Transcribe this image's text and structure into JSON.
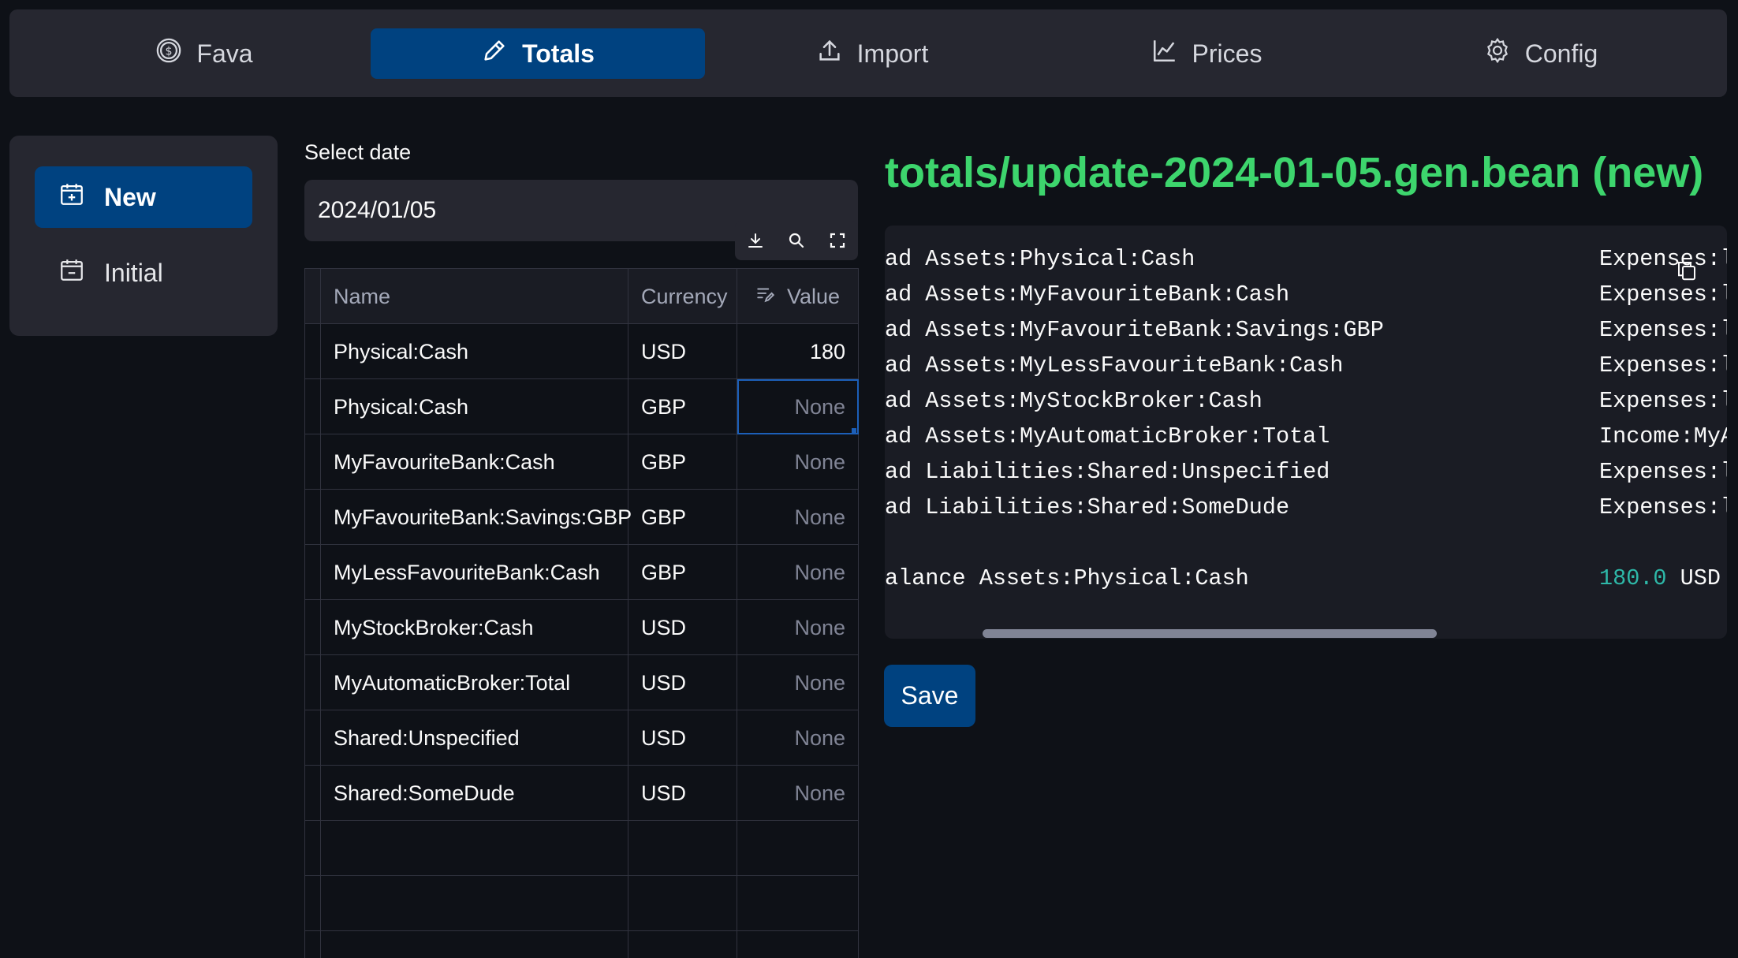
{
  "nav": {
    "items": [
      {
        "label": "Fava",
        "icon": "dollar-circle-icon"
      },
      {
        "label": "Totals",
        "icon": "pencil-icon"
      },
      {
        "label": "Import",
        "icon": "upload-icon"
      },
      {
        "label": "Prices",
        "icon": "line-chart-icon"
      },
      {
        "label": "Config",
        "icon": "gear-icon"
      }
    ],
    "active": "Totals"
  },
  "sidebar": {
    "items": [
      {
        "label": "New",
        "icon": "calendar-plus-icon"
      },
      {
        "label": "Initial",
        "icon": "calendar-minus-icon"
      }
    ],
    "active": "New"
  },
  "date": {
    "label": "Select date",
    "value": "2024/01/05"
  },
  "table": {
    "toolbar": [
      "download-icon",
      "search-icon",
      "fullscreen-icon"
    ],
    "columns": [
      "Name",
      "Currency",
      "Value"
    ],
    "rows": [
      {
        "name": "Physical:Cash",
        "currency": "USD",
        "value": "180"
      },
      {
        "name": "Physical:Cash",
        "currency": "GBP",
        "value": "None"
      },
      {
        "name": "MyFavouriteBank:Cash",
        "currency": "GBP",
        "value": "None"
      },
      {
        "name": "MyFavouriteBank:Savings:GBP",
        "currency": "GBP",
        "value": "None"
      },
      {
        "name": "MyLessFavouriteBank:Cash",
        "currency": "GBP",
        "value": "None"
      },
      {
        "name": "MyStockBroker:Cash",
        "currency": "USD",
        "value": "None"
      },
      {
        "name": "MyAutomaticBroker:Total",
        "currency": "USD",
        "value": "None"
      },
      {
        "name": "Shared:Unspecified",
        "currency": "USD",
        "value": "None"
      },
      {
        "name": "Shared:SomeDude",
        "currency": "USD",
        "value": "None"
      }
    ],
    "empty_rows": 3
  },
  "file": {
    "title": "totals/update-2024-01-05.gen.bean (new)",
    "code_lines": [
      {
        "left": "ad Assets:Physical:Cash",
        "right": "Expenses:l"
      },
      {
        "left": "ad Assets:MyFavouriteBank:Cash",
        "right": "Expenses:l"
      },
      {
        "left": "ad Assets:MyFavouriteBank:Savings:GBP",
        "right": "Expenses:l"
      },
      {
        "left": "ad Assets:MyLessFavouriteBank:Cash",
        "right": "Expenses:l"
      },
      {
        "left": "ad Assets:MyStockBroker:Cash",
        "right": "Expenses:l"
      },
      {
        "left": "ad Assets:MyAutomaticBroker:Total",
        "right": "Income:MyA"
      },
      {
        "left": "ad Liabilities:Shared:Unspecified",
        "right": "Expenses:l"
      },
      {
        "left": "ad Liabilities:Shared:SomeDude",
        "right": "Expenses:l"
      },
      {
        "left": "",
        "right": ""
      },
      {
        "left": "alance Assets:Physical:Cash",
        "right_num": "180.0",
        "right_unit": " USD"
      }
    ]
  },
  "save_label": "Save",
  "colors": {
    "background": "#0e1117",
    "panel": "#262730",
    "accent": "#004280",
    "title_green": "#3dd56d",
    "number_teal": "#2eb8a8"
  }
}
